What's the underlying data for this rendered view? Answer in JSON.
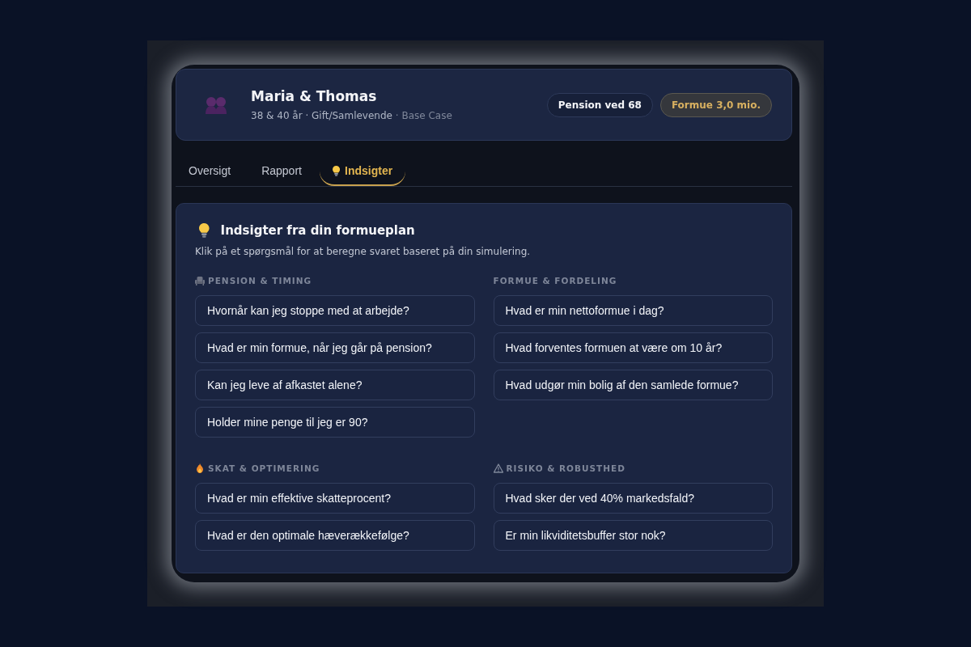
{
  "profile": {
    "name": "Maria & Thomas",
    "details": "38 & 40 år · Gift/Samlevende",
    "scenario": "· Base Case",
    "badges": [
      {
        "label": "Pension ved 68",
        "kind": "neutral"
      },
      {
        "label": "Formue 3,0 mio.",
        "kind": "highlight"
      }
    ]
  },
  "tabs": [
    {
      "label": "Oversigt",
      "selected": false,
      "kind": "plain"
    },
    {
      "label": "Rapport",
      "selected": false,
      "kind": "plain"
    },
    {
      "label": "Indsigter",
      "selected": true,
      "kind": "bulb"
    }
  ],
  "insights": {
    "title": "Indsigter fra din formueplan",
    "subtitle": "Klik på et spørgsmål for at beregne svaret baseret på din simulering.",
    "sections": [
      {
        "kind": "pension",
        "label": "PENSION & TIMING",
        "questions": [
          "Hvornår kan jeg stoppe med at arbejde?",
          "Hvad er min formue, når jeg går på pension?",
          "Kan jeg leve af afkastet alene?",
          "Holder mine penge til jeg er 90?"
        ]
      },
      {
        "kind": "formue",
        "label": "FORMUE & FORDELING",
        "questions": [
          "Hvad er min nettoformue i dag?",
          "Hvad forventes formuen at være om 10 år?",
          "Hvad udgør min bolig af den samlede formue?"
        ]
      },
      {
        "kind": "skat",
        "label": "SKAT & OPTIMERING",
        "questions": [
          "Hvad er min effektive skatteprocent?",
          "Hvad er den optimale hæverækkefølge?"
        ]
      },
      {
        "kind": "risiko",
        "label": "RISIKO & ROBUSTHED",
        "questions": [
          "Hvad sker der ved 40% markedsfald?",
          "Er min likviditetsbuffer stor nok?"
        ]
      }
    ]
  }
}
